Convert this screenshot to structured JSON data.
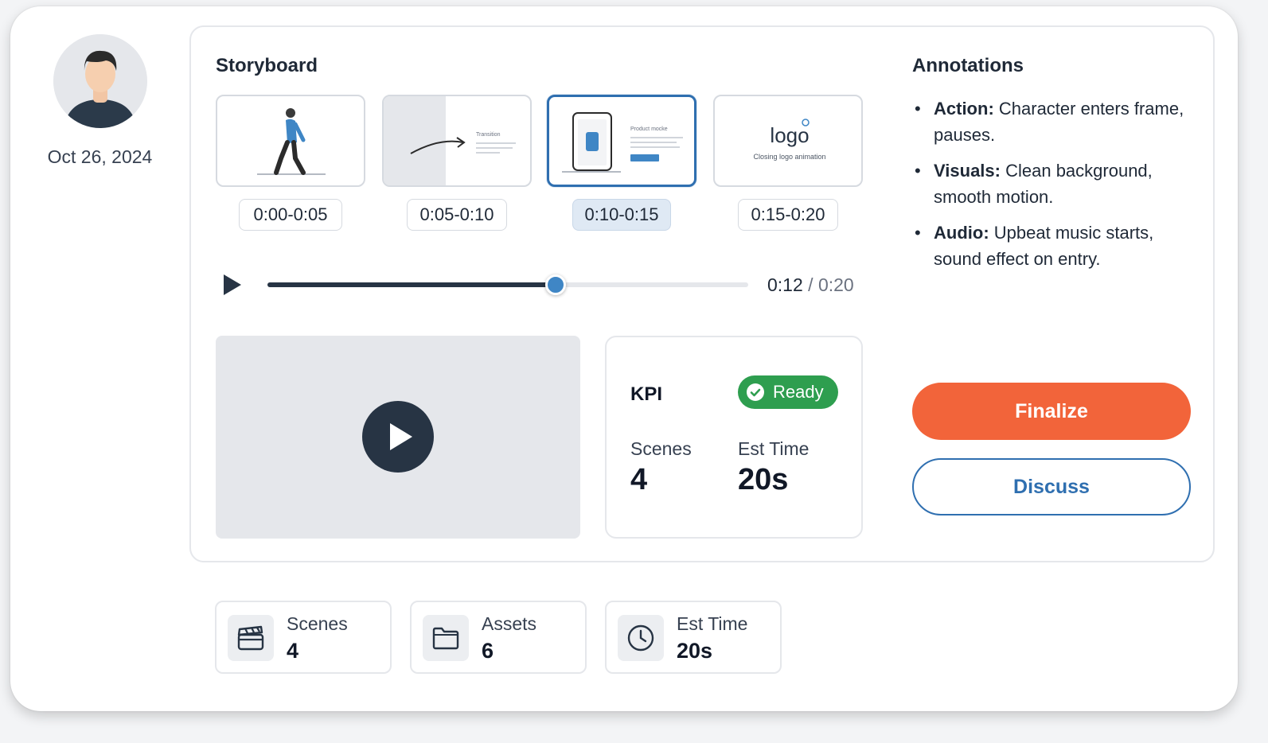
{
  "profile": {
    "date": "Oct 26, 2024"
  },
  "storyboard": {
    "title": "Storyboard",
    "thumbnails": [
      {
        "time": "0:00-0:05",
        "active": false
      },
      {
        "time": "0:05-0:10",
        "caption": "Transition",
        "active": false
      },
      {
        "time": "0:10-0:15",
        "caption": "Product mocke",
        "active": true
      },
      {
        "time": "0:15-0:20",
        "logo": "logo",
        "caption": "Closing logo animation",
        "active": false
      }
    ]
  },
  "player": {
    "current": "0:12",
    "separator": " / ",
    "total": "0:20",
    "progress": 0.6
  },
  "kpi": {
    "title": "KPI",
    "status": "Ready",
    "scenes_label": "Scenes",
    "scenes_value": "4",
    "time_label": "Est Time",
    "time_value": "20s"
  },
  "annotations": {
    "title": "Annotations",
    "items": [
      {
        "label": "Action:",
        "text": " Character enters frame, pauses."
      },
      {
        "label": "Visuals:",
        "text": " Clean background, smooth motion."
      },
      {
        "label": "Audio:",
        "text": " Upbeat music starts, sound effect on entry."
      }
    ]
  },
  "actions": {
    "finalize": "Finalize",
    "discuss": "Discuss"
  },
  "stats": [
    {
      "label": "Scenes",
      "value": "4",
      "icon": "clapperboard-icon"
    },
    {
      "label": "Assets",
      "value": "6",
      "icon": "folder-icon"
    },
    {
      "label": "Est Time",
      "value": "20s",
      "icon": "clock-icon"
    }
  ],
  "colors": {
    "accent": "#f2643a",
    "primary": "#2f6fb0",
    "success": "#2e9e4f",
    "dark": "#273444"
  }
}
